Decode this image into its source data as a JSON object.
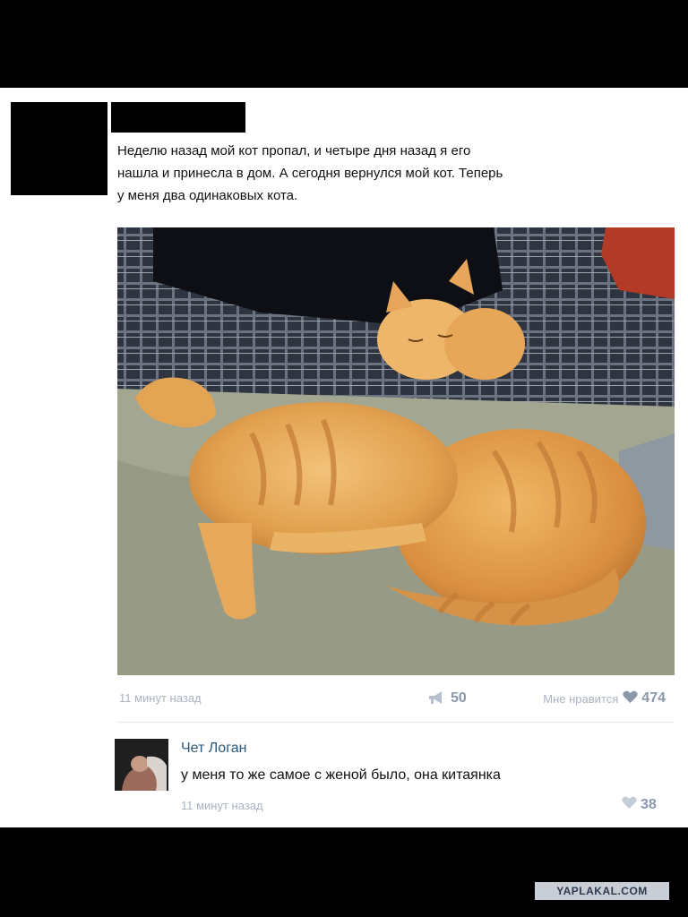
{
  "post": {
    "text_lines": [
      "Неделю назад мой кот пропал, и четыре дня назад я его",
      "нашла и принесла в дом. А сегодня вернулся мой кот. Теперь",
      "у меня два одинаковых кота."
    ],
    "photo_icon": "two-orange-tabby-cats-photo",
    "time": "11 минут назад",
    "shares": "50",
    "like_label": "Мне нравится",
    "likes": "474"
  },
  "comment": {
    "author": "Чет Логан",
    "text": "у меня то же самое с женой было, она китаянка",
    "time": "11 минут назад",
    "likes": "38"
  },
  "watermark": "YAPLAKAL.COM",
  "colors": {
    "accent": "#2b587a",
    "muted": "#aab3c3",
    "count": "#8a97ab"
  }
}
